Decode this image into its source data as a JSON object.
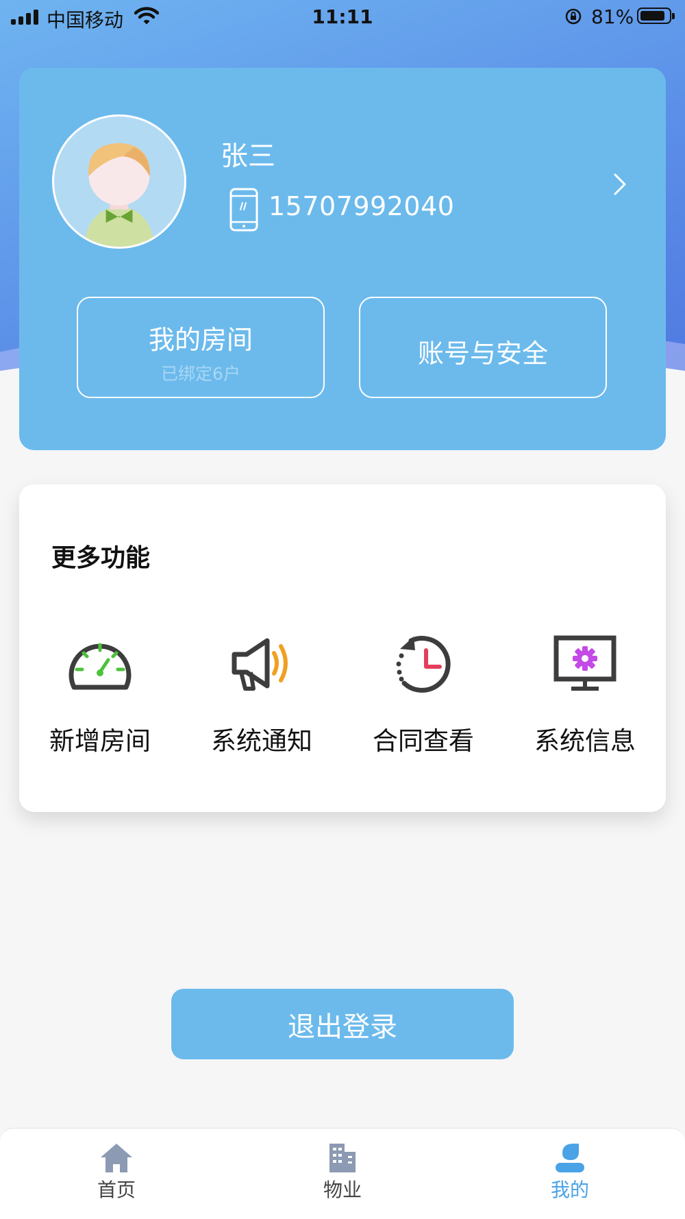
{
  "status_bar": {
    "carrier": "中国移动",
    "time": "11:11",
    "battery": "81%"
  },
  "profile": {
    "name": "张三",
    "phone": "15707992040",
    "buttons": {
      "rooms_title": "我的房间",
      "rooms_sub": "已绑定6户",
      "account_title": "账号与安全"
    }
  },
  "more": {
    "title": "更多功能",
    "items": [
      {
        "label": "新增房间",
        "icon": "speedometer-icon"
      },
      {
        "label": "系统通知",
        "icon": "megaphone-icon"
      },
      {
        "label": "合同查看",
        "icon": "history-clock-icon"
      },
      {
        "label": "系统信息",
        "icon": "monitor-gear-icon"
      }
    ]
  },
  "logout_label": "退出登录",
  "tabs": [
    {
      "label": "首页",
      "icon": "home-icon"
    },
    {
      "label": "物业",
      "icon": "building-icon"
    },
    {
      "label": "我的",
      "icon": "user-icon",
      "active": true
    }
  ],
  "colors": {
    "accent": "#6cbaec",
    "tab_active": "#4aa3e6",
    "tab_inactive_icon": "#8c9ab3"
  }
}
